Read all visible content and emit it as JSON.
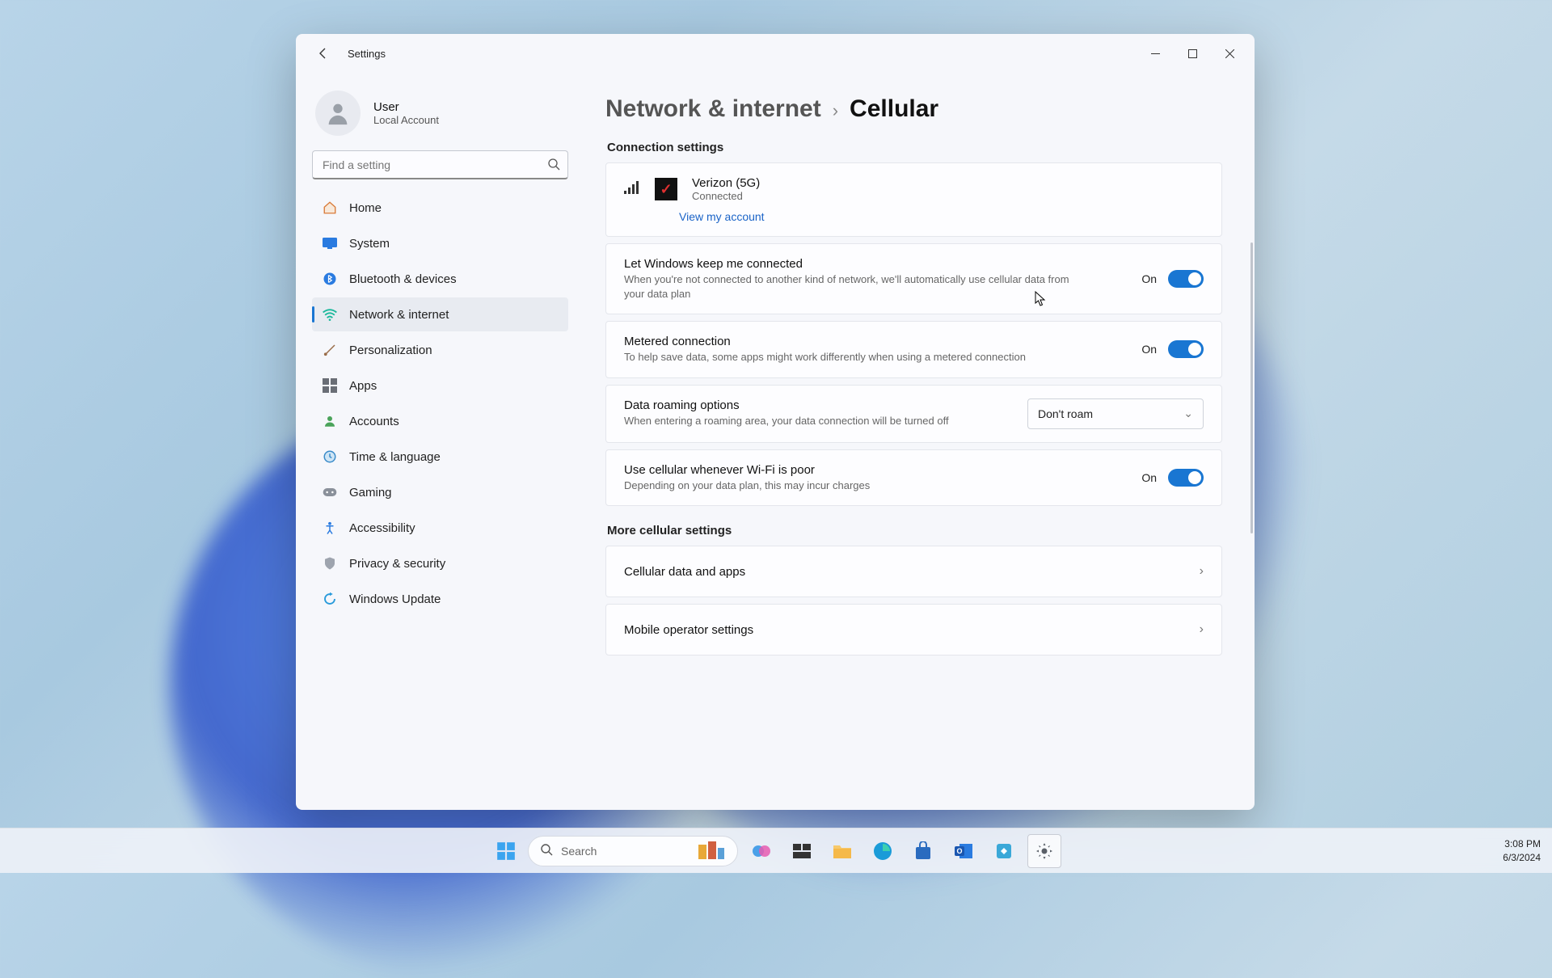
{
  "window": {
    "title": "Settings",
    "controls": {
      "minimize": "−",
      "maximize": "☐",
      "close": "✕"
    }
  },
  "user": {
    "name": "User",
    "account_type": "Local Account"
  },
  "search": {
    "placeholder": "Find a setting"
  },
  "sidebar": {
    "items": [
      {
        "label": "Home",
        "icon": "home-icon"
      },
      {
        "label": "System",
        "icon": "system-icon"
      },
      {
        "label": "Bluetooth & devices",
        "icon": "bluetooth-icon"
      },
      {
        "label": "Network & internet",
        "icon": "wifi-icon"
      },
      {
        "label": "Personalization",
        "icon": "brush-icon"
      },
      {
        "label": "Apps",
        "icon": "apps-icon"
      },
      {
        "label": "Accounts",
        "icon": "accounts-icon"
      },
      {
        "label": "Time & language",
        "icon": "clock-icon"
      },
      {
        "label": "Gaming",
        "icon": "gamepad-icon"
      },
      {
        "label": "Accessibility",
        "icon": "accessibility-icon"
      },
      {
        "label": "Privacy & security",
        "icon": "shield-icon"
      },
      {
        "label": "Windows Update",
        "icon": "update-icon"
      }
    ],
    "active_index": 3
  },
  "breadcrumb": {
    "parent": "Network & internet",
    "current": "Cellular"
  },
  "sections": {
    "connection": {
      "heading": "Connection settings",
      "carrier": "Verizon (5G)",
      "status": "Connected",
      "view_account": "View my account"
    },
    "settings": [
      {
        "title": "Let Windows keep me connected",
        "desc": "When you're not connected to another kind of network, we'll automatically use cellular data from your data plan",
        "control": "toggle",
        "state_label": "On"
      },
      {
        "title": "Metered connection",
        "desc": "To help save data, some apps might work differently when using a metered connection",
        "control": "toggle",
        "state_label": "On"
      },
      {
        "title": "Data roaming options",
        "desc": "When entering a roaming area, your data connection will be turned off",
        "control": "dropdown",
        "value": "Don't roam"
      },
      {
        "title": "Use cellular whenever Wi-Fi is poor",
        "desc": "Depending on your data plan, this may incur charges",
        "control": "toggle",
        "state_label": "On"
      }
    ],
    "more": {
      "heading": "More cellular settings",
      "items": [
        {
          "label": "Cellular data and apps"
        },
        {
          "label": "Mobile operator settings"
        }
      ]
    }
  },
  "taskbar": {
    "search_placeholder": "Search",
    "time": "3:08 PM",
    "date": "6/3/2024"
  }
}
